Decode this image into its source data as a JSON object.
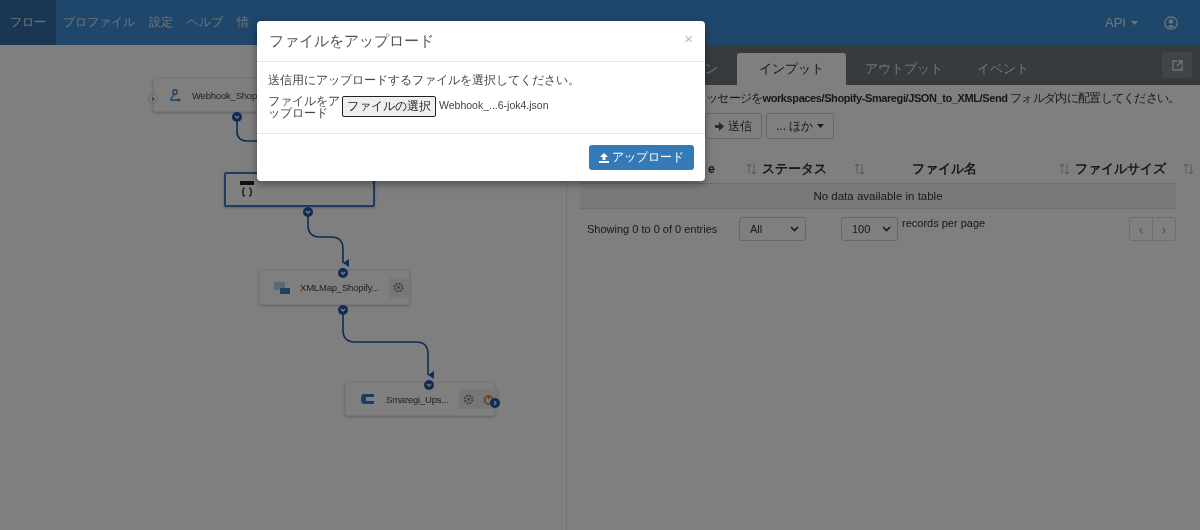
{
  "nav": {
    "items": [
      {
        "label": "フロー",
        "selected": true
      },
      {
        "label": "プロファイル",
        "selected": false
      },
      {
        "label": "設定",
        "selected": false
      },
      {
        "label": "ヘルプ",
        "selected": false
      },
      {
        "label": "情",
        "selected": false
      }
    ],
    "api_menu": "API"
  },
  "flow": {
    "nodes": [
      {
        "kind": "webhook",
        "label": "Webhook_Shop",
        "selected": false
      },
      {
        "kind": "json",
        "selected": true
      },
      {
        "kind": "xmlmap",
        "label": "XMLMap_Shopify...",
        "selected": false
      },
      {
        "kind": "smaregi",
        "label": "Smaregi_Ups...",
        "selected": false
      }
    ]
  },
  "panel": {
    "tabs": [
      {
        "label": "ン",
        "selected": false
      },
      {
        "label": "インプット",
        "selected": true
      },
      {
        "label": "アウトプット",
        "selected": false
      },
      {
        "label": "イベント",
        "selected": false
      }
    ],
    "info": "ッセージを**workspaces/Shopify-Smaregi/JSON_to_XML/Send** フォルダ内に配置してください。",
    "buttons": [
      {
        "kind": "send",
        "label": "送信"
      },
      {
        "kind": "more",
        "label": "... ほか"
      }
    ],
    "table": {
      "columns": [
        "e",
        "ステータス",
        "ファイル名",
        "ファイルサイズ"
      ],
      "empty_message": "No data available in table"
    },
    "footer": {
      "info": "Showing 0 to 0 of 0 entries",
      "filter": "All",
      "page_size": "100",
      "page_size_label": "records per page",
      "pager": [
        "‹",
        "›"
      ]
    }
  },
  "modal": {
    "title": "ファイルをアップロード",
    "close": "×",
    "message": "送信用にアップロードするファイルを選択してください。",
    "field_label": "ファイルをアップロード",
    "file_button": "ファイルの選択",
    "file_name": "Webhook_...6-jok4.json",
    "submit": "アップロード"
  }
}
